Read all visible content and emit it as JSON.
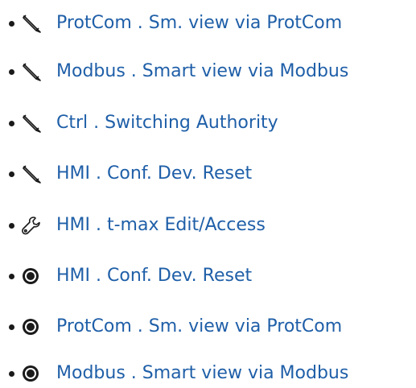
{
  "items": [
    {
      "icon": "pencil-icon",
      "label": "ProtCom . Sm. view via ProtCom"
    },
    {
      "icon": "pencil-icon",
      "label": "Modbus . Smart view via Modbus"
    },
    {
      "icon": "pencil-icon",
      "label": "Ctrl . Switching Authority"
    },
    {
      "icon": "pencil-icon",
      "label": "HMI . Conf. Dev. Reset"
    },
    {
      "icon": "wrench-icon",
      "label": "HMI . t-max Edit/Access"
    },
    {
      "icon": "bullseye-icon",
      "label": "HMI . Conf. Dev. Reset"
    },
    {
      "icon": "bullseye-icon",
      "label": "ProtCom . Sm. view via ProtCom"
    },
    {
      "icon": "bullseye-icon",
      "label": "Modbus . Smart view via Modbus"
    }
  ],
  "colors": {
    "link": "#1f5fa8",
    "text": "#1a1a1a"
  }
}
